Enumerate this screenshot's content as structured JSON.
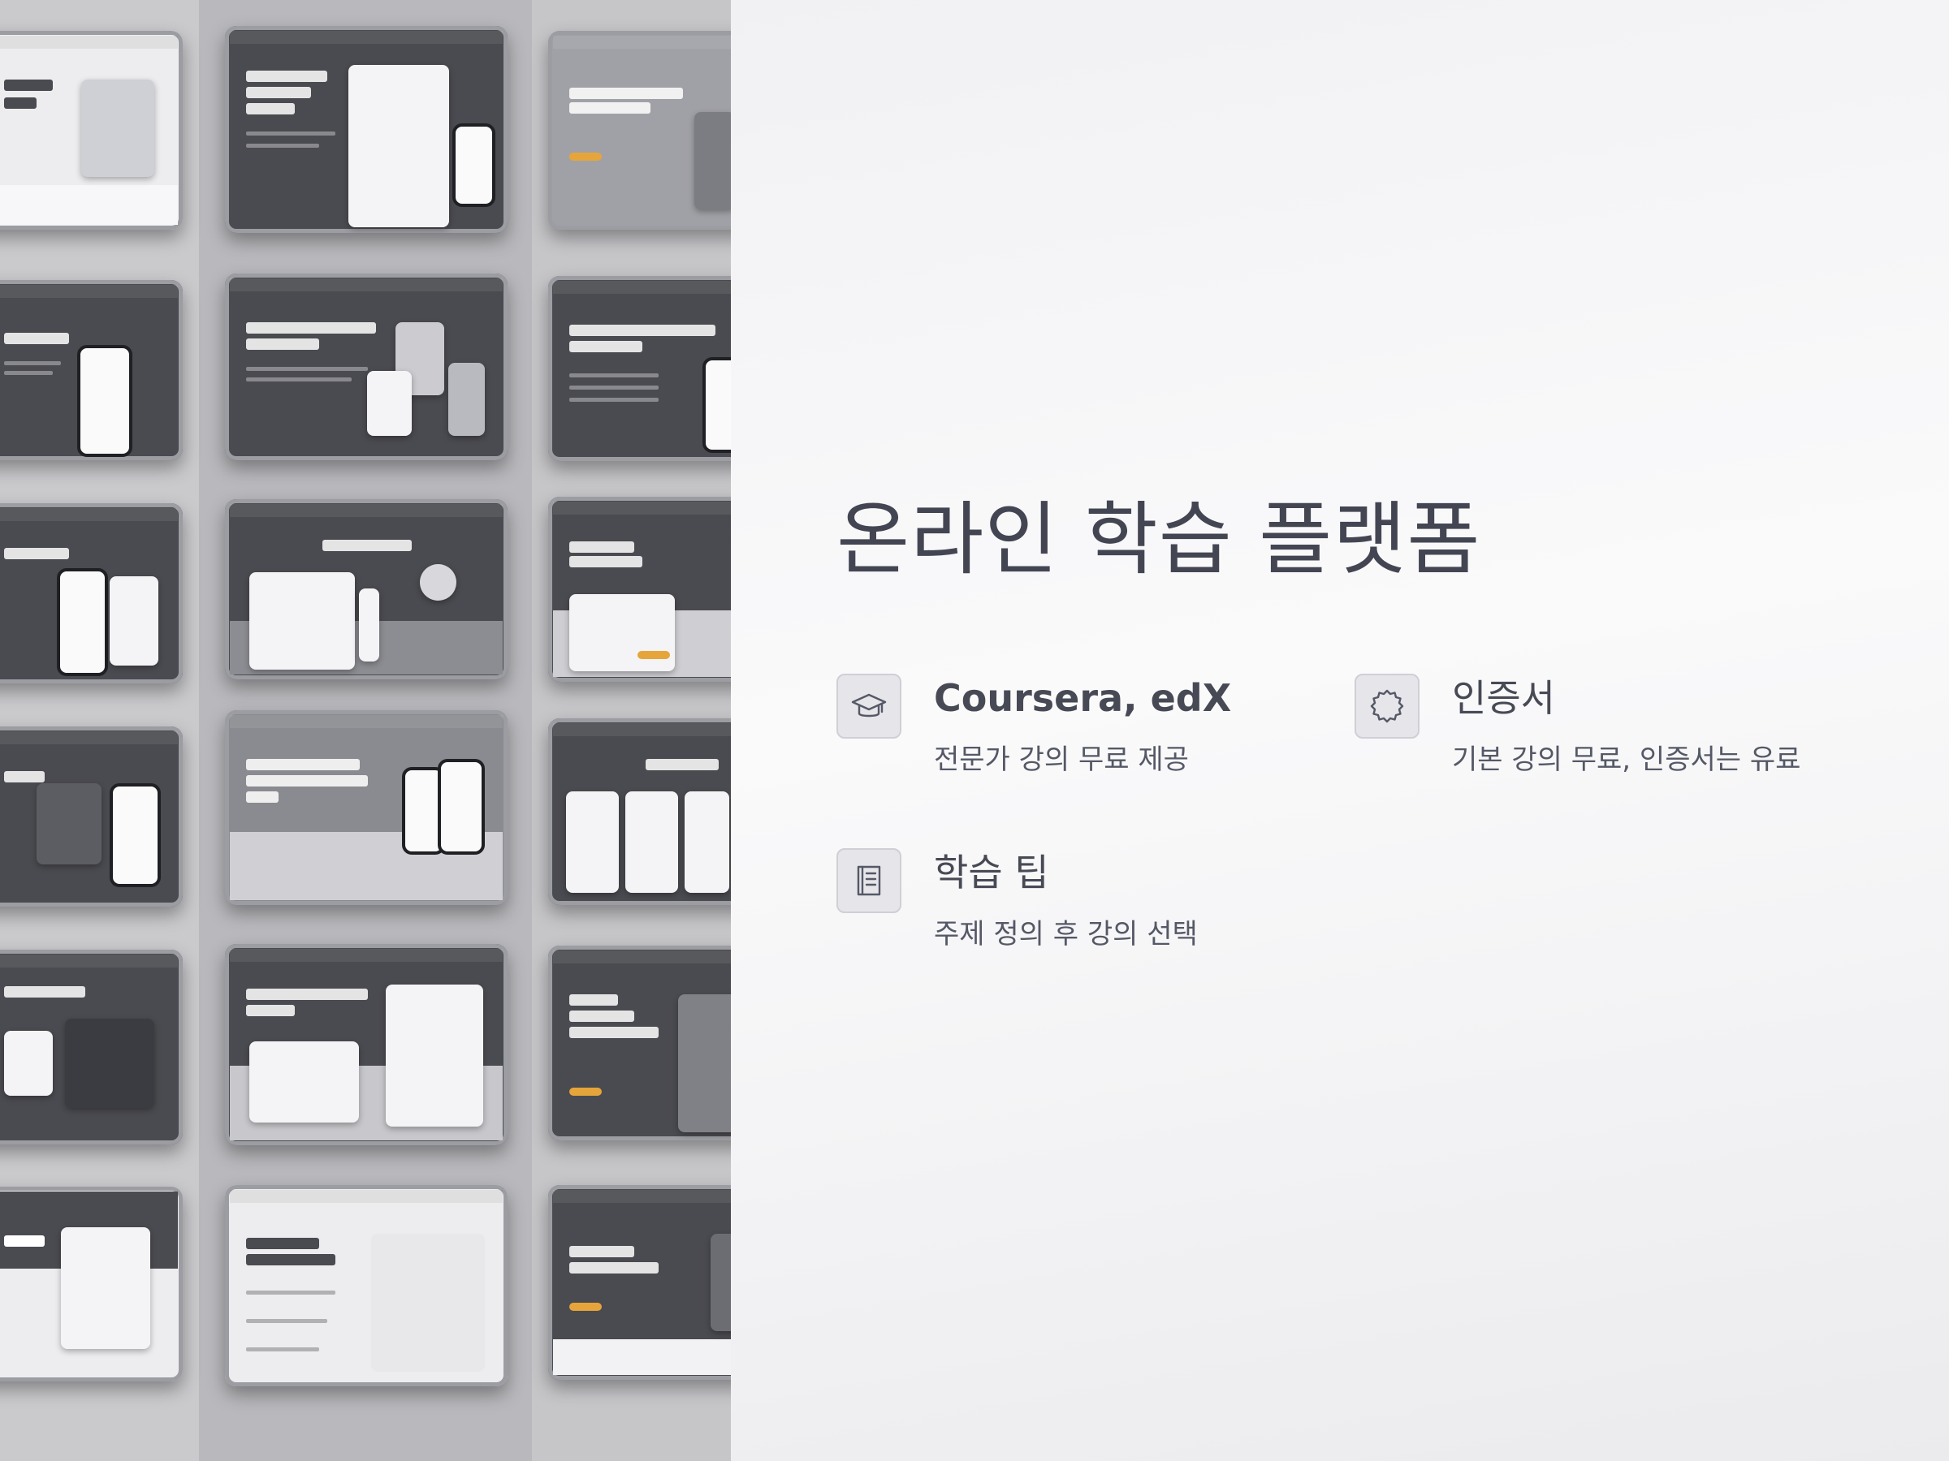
{
  "slide": {
    "title": "온라인 학습 플랫폼",
    "features": [
      {
        "icon": "graduation-cap-icon",
        "title": "Coursera, edX",
        "description": "전문가 강의 무료 제공"
      },
      {
        "icon": "badge-icon",
        "title": "인증서",
        "description": "기본 강의 무료, 인증서는 유료"
      },
      {
        "icon": "book-icon",
        "title": "학습 팁",
        "description": "주제 정의 후 강의 선택"
      }
    ]
  },
  "mosaic": {
    "description_free": true,
    "accent_color": "#e6a53a",
    "dark_color": "#4a4b50"
  },
  "colors": {
    "title": "#434652",
    "text": "#555866",
    "icon_box": "#e5e5ea"
  }
}
